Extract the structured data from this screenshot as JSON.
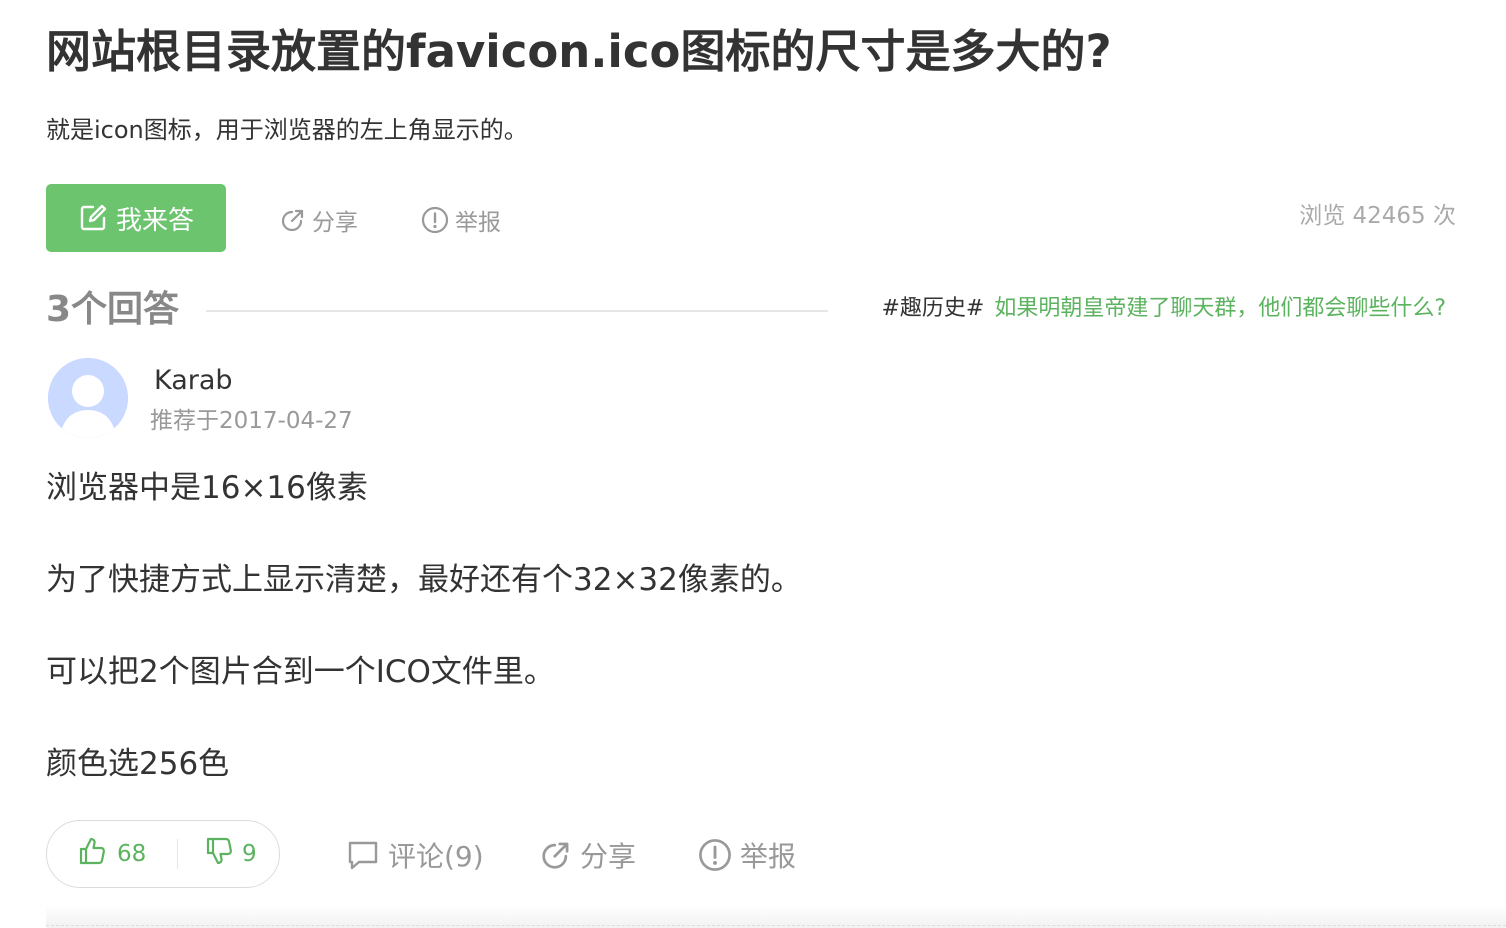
{
  "question": {
    "title": "网站根目录放置的favicon.ico图标的尺寸是多大的?",
    "description": "就是icon图标，用于浏览器的左上角显示的。",
    "answer_button": "我来答",
    "share_label": "分享",
    "report_label": "举报",
    "views": "浏览 42465 次"
  },
  "answers_header": {
    "count_label": "3个回答",
    "topic_tag": "#趣历史#",
    "topic_link": "如果明朝皇帝建了聊天群，他们都会聊些什么?"
  },
  "answer": {
    "username": "Karab",
    "recommended": "推荐于2017-04-27",
    "paragraphs": [
      "浏览器中是16×16像素",
      "为了快捷方式上显示清楚，最好还有个32×32像素的。",
      "可以把2个图片合到一个ICO文件里。",
      "颜色选256色"
    ],
    "upvotes": "68",
    "downvotes": "9",
    "comment_label": "评论(9)",
    "share_label": "分享",
    "report_label": "举报"
  },
  "colors": {
    "accent": "#6cc46f",
    "link": "#5cb35f",
    "muted": "#999999",
    "text": "#333333",
    "avatar": "#c9d9ff"
  },
  "icons": [
    "edit-icon",
    "share-icon",
    "report-icon",
    "user-avatar-icon",
    "thumbs-up-icon",
    "thumbs-down-icon",
    "comment-icon"
  ]
}
